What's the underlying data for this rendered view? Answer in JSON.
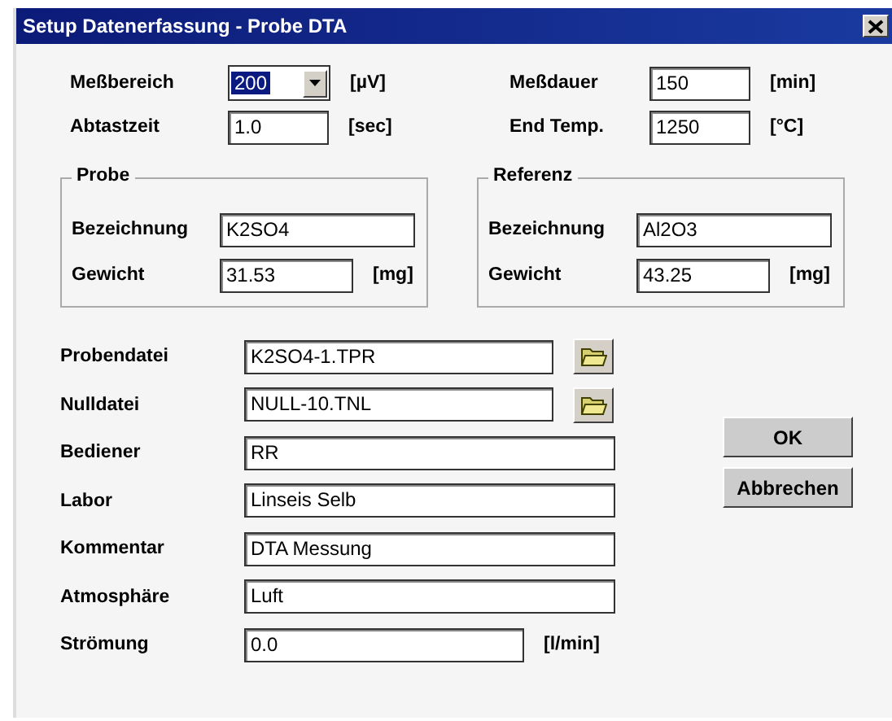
{
  "window": {
    "title": "Setup Datenerfassung - Probe DTA"
  },
  "top_fields": [
    {
      "label": "Meßbereich",
      "value": "200",
      "unit": "[µV]",
      "kind": "combo",
      "highlighted": true
    },
    {
      "label": "Meßdauer",
      "value": "150",
      "unit": "[min]",
      "kind": "text",
      "highlighted": false
    },
    {
      "label": "Abtastzeit",
      "value": "1.0",
      "unit": "[sec]",
      "kind": "text",
      "highlighted": false
    },
    {
      "label": "End Temp.",
      "value": "1250",
      "unit": "[°C]",
      "kind": "text",
      "highlighted": false
    }
  ],
  "groups": [
    {
      "title": "Probe",
      "fields": [
        {
          "label": "Bezeichnung",
          "value": "K2SO4"
        },
        {
          "label": "Gewicht",
          "value": "31.53",
          "unit": "[mg]"
        }
      ]
    },
    {
      "title": "Referenz",
      "fields": [
        {
          "label": "Bezeichnung",
          "value": "Al2O3"
        },
        {
          "label": "Gewicht",
          "value": "43.25",
          "unit": "[mg]"
        }
      ]
    }
  ],
  "fields": [
    {
      "label": "Probendatei",
      "value": "K2SO4-1.TPR",
      "kind": "file"
    },
    {
      "label": "Nulldatei",
      "value": "NULL-10.TNL",
      "kind": "file"
    },
    {
      "label": "Bediener",
      "value": "RR",
      "kind": "text"
    },
    {
      "label": "Labor",
      "value": "Linseis Selb",
      "kind": "text"
    },
    {
      "label": "Kommentar",
      "value": "DTA Messung",
      "kind": "text"
    },
    {
      "label": "Atmosphäre",
      "value": "Luft",
      "kind": "text"
    },
    {
      "label": "Strömung",
      "value": "0.0",
      "unit": "[l/min]",
      "kind": "unit"
    }
  ],
  "buttons": [
    "OK",
    "Abbrechen"
  ]
}
